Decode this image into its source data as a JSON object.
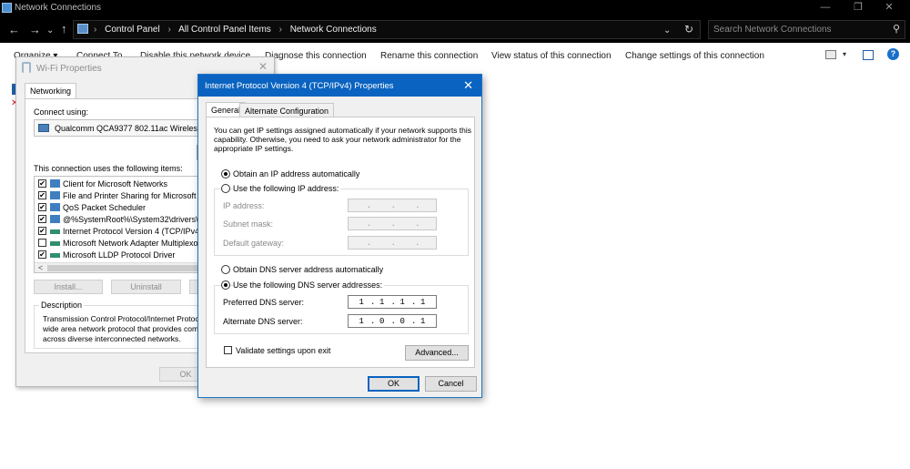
{
  "explorer": {
    "title": "Network Connections",
    "breadcrumbs": [
      "Control Panel",
      "All Control Panel Items",
      "Network Connections"
    ],
    "search_placeholder": "Search Network Connections",
    "commands": [
      "Organize ▾",
      "Connect To",
      "Disable this network device",
      "Diagnose this connection",
      "Rename this connection",
      "View status of this connection",
      "Change settings of this connection"
    ]
  },
  "wifi": {
    "title": "Wi-Fi Properties",
    "tab": "Networking",
    "connect_using_label": "Connect using:",
    "adapter": "Qualcomm QCA9377 802.11ac Wireless Ad",
    "items_label": "This connection uses the following items:",
    "items": [
      {
        "label": "Client for Microsoft Networks",
        "checked": true
      },
      {
        "label": "File and Printer Sharing for Microsoft Netw",
        "checked": true
      },
      {
        "label": "QoS Packet Scheduler",
        "checked": true
      },
      {
        "label": "@%SystemRoot%\\System32\\drivers\\l2bri",
        "checked": true
      },
      {
        "label": "Internet Protocol Version 4 (TCP/IPv4)",
        "checked": true
      },
      {
        "label": "Microsoft Network Adapter Multiplexor Pr",
        "checked": false
      },
      {
        "label": "Microsoft LLDP Protocol Driver",
        "checked": true
      }
    ],
    "install_label": "Install...",
    "uninstall_label": "Uninstall",
    "description_label": "Description",
    "description": "Transmission Control Protocol/Internet Protocol. The default wide area network protocol that provides communication across diverse interconnected networks.",
    "ok_label": "OK"
  },
  "ipv4": {
    "title": "Internet Protocol Version 4 (TCP/IPv4) Properties",
    "tabs": [
      "General",
      "Alternate Configuration"
    ],
    "intro": "You can get IP settings assigned automatically if your network supports this capability. Otherwise, you need to ask your network administrator for the appropriate IP settings.",
    "ip_auto_label": "Obtain an IP address automatically",
    "ip_manual_label": "Use the following IP address:",
    "ip_address_label": "IP address:",
    "subnet_label": "Subnet mask:",
    "gateway_label": "Default gateway:",
    "dns_auto_label": "Obtain DNS server address automatically",
    "dns_manual_label": "Use the following DNS server addresses:",
    "preferred_dns_label": "Preferred DNS server:",
    "preferred_dns": [
      "1",
      "1",
      "1",
      "1"
    ],
    "alternate_dns_label": "Alternate DNS server:",
    "alternate_dns": [
      "1",
      "0",
      "0",
      "1"
    ],
    "validate_label": "Validate settings upon exit",
    "advanced_label": "Advanced...",
    "ok_label": "OK",
    "cancel_label": "Cancel"
  }
}
